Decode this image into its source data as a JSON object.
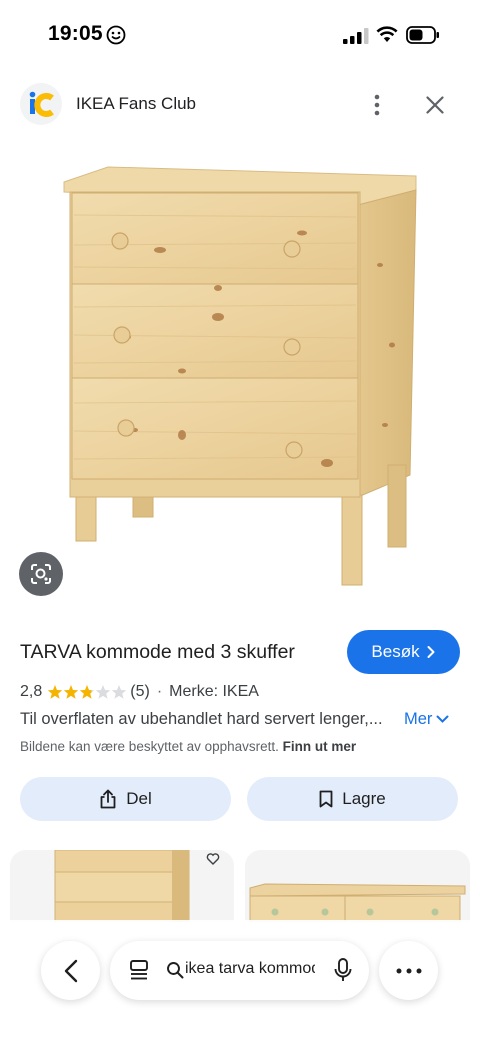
{
  "status_bar": {
    "time": "19:05"
  },
  "source": {
    "name": "IKEA Fans Club",
    "logo_icon": "ic-logo-icon",
    "logo_colors": [
      "#1a73e8",
      "#fbbc04"
    ]
  },
  "product": {
    "title": "TARVA kommode med 3 skuffer",
    "visit_label": "Besøk",
    "rating_value": "2,8",
    "rating_stars": 2.8,
    "review_count": "(5)",
    "brand": "Merke: IKEA",
    "description": "Til overflaten av ubehandlet hard servert lenger,...",
    "more_label": "Mer",
    "copyright_text": "Bildene kan være beskyttet av opphavsrett.",
    "learn_more_label": "Finn ut mer"
  },
  "actions": {
    "share_label": "Del",
    "save_label": "Lagre"
  },
  "search_bar": {
    "query": "ikea tarva kommode"
  },
  "colors": {
    "accent": "#1a73e8",
    "star": "#f4b400",
    "button_bg": "#e3ecfb"
  }
}
